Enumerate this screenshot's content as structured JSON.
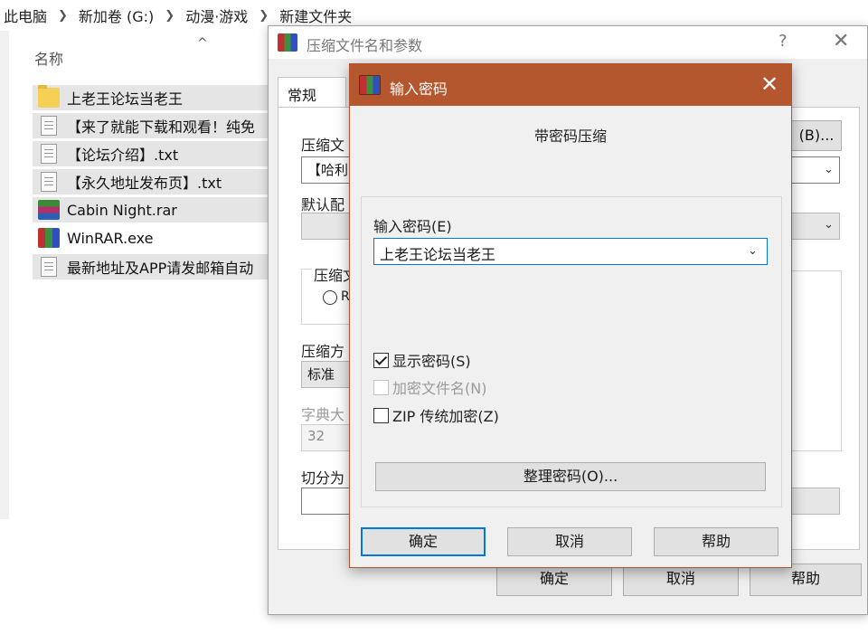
{
  "explorer": {
    "breadcrumb": [
      "此电脑",
      "新加卷 (G:)",
      "动漫·游戏",
      "新建文件夹"
    ],
    "column_header": "名称",
    "sort_caret": "^",
    "files": [
      {
        "name": "上老王论坛当老王",
        "type": "folder"
      },
      {
        "name": "【来了就能下载和观看！纯免",
        "type": "txt"
      },
      {
        "name": "【论坛介绍】.txt",
        "type": "txt"
      },
      {
        "name": "【永久地址发布页】.txt",
        "type": "txt"
      },
      {
        "name": "Cabin Night.rar",
        "type": "rar"
      },
      {
        "name": "WinRAR.exe",
        "type": "exe"
      },
      {
        "name": "最新地址及APP请发邮箱自动",
        "type": "txt"
      }
    ]
  },
  "rar_dialog": {
    "title": "压缩文件名和参数",
    "help": "?",
    "close": "✕",
    "tab": "常规",
    "archive_name_label": "压缩文",
    "archive_name_value": "【哈利",
    "browse_button": "(B)...",
    "default_profile_label": "默认配",
    "format_group_label": "压缩文",
    "radio_label": "R",
    "method_label": "压缩方",
    "method_value": "标准",
    "dict_label": "字典大",
    "dict_value": "32",
    "split_label": "切分为",
    "ok": "确定",
    "cancel": "取消",
    "help_button": "帮助"
  },
  "pwd_dialog": {
    "title": "输入密码",
    "close": "✕",
    "heading": "带密码压缩",
    "password_label": "输入密码(E)",
    "password_value": "上老王论坛当老王",
    "show_password": {
      "label": "显示密码(S)",
      "checked": true
    },
    "encrypt_filenames": {
      "label": "加密文件名(N)",
      "checked": false,
      "disabled": true
    },
    "zip_legacy": {
      "label": "ZIP 传统加密(Z)",
      "checked": false
    },
    "organize_button": "整理密码(O)...",
    "ok": "确定",
    "cancel": "取消",
    "help": "帮助"
  }
}
